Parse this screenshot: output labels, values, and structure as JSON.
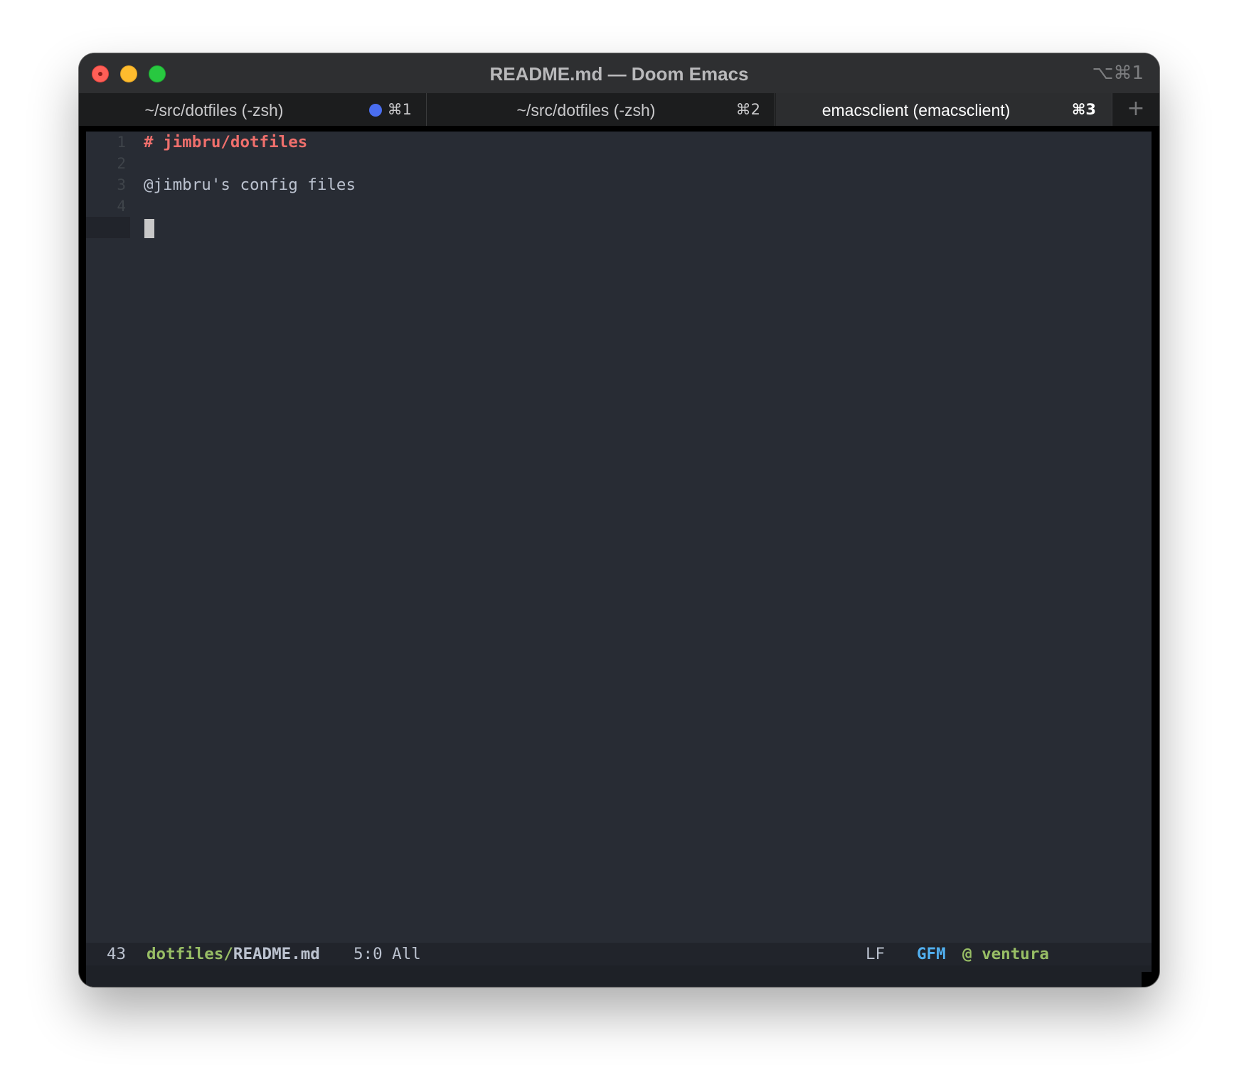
{
  "window": {
    "title": "README.md — Doom Emacs",
    "shortcut": "⌥⌘1"
  },
  "tabs": [
    {
      "label": "~/src/dotfiles (-zsh)",
      "shortcut": "⌘1",
      "active": false,
      "has_activity": true
    },
    {
      "label": "~/src/dotfiles (-zsh)",
      "shortcut": "⌘2",
      "active": false
    },
    {
      "label": "emacsclient (emacsclient)",
      "shortcut": "⌘3",
      "active": true
    }
  ],
  "new_tab_symbol": "+",
  "editor": {
    "lines": [
      {
        "number": "1",
        "text": "# jimbru/dotfiles",
        "style": "heading"
      },
      {
        "number": "2",
        "text": ""
      },
      {
        "number": "3",
        "text": "@jimbru's config files"
      },
      {
        "number": "4",
        "text": ""
      }
    ],
    "cursor_line": 5
  },
  "modeline": {
    "count": "43",
    "dir": "dotfiles/",
    "file": "README.md",
    "position": "5:0 All",
    "eol": "LF",
    "mode": "GFM",
    "host": "@ ventura"
  },
  "colors": {
    "heading": "#ef6f6c",
    "text": "#bbc2cf",
    "green": "#98be65",
    "blue": "#51afef",
    "editor_bg": "#282c34",
    "activity_dot": "#4a6ef0"
  }
}
